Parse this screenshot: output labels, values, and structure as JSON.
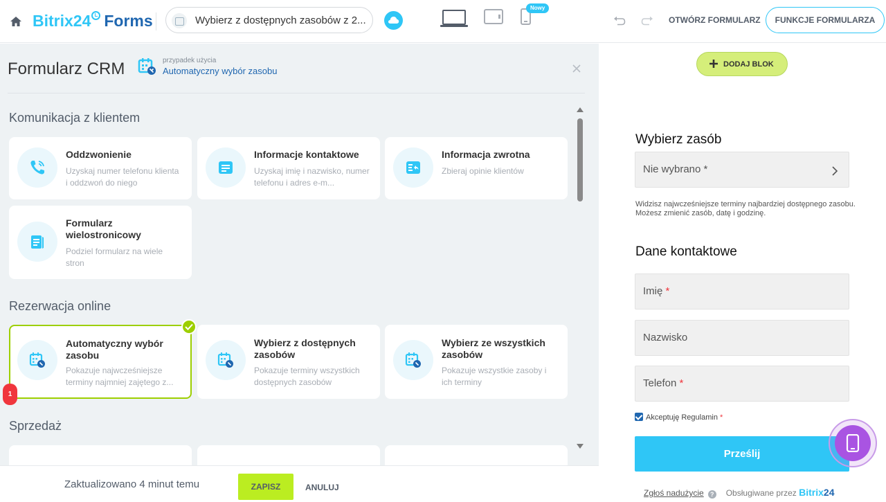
{
  "header": {
    "logo_bitrix": "Bitrix24",
    "logo_forms": "Forms",
    "scenario_select": "Wybierz z dostępnych zasobów z 2...",
    "new_badge": "Nowy",
    "open_form": "OTWÓRZ FORMULARZ",
    "form_features": "FUNKCJE FORMULARZA"
  },
  "panel": {
    "title": "Formularz CRM",
    "use_case_label": "przypadek użycia",
    "use_case_value": "Automatyczny wybór zasobu",
    "sections": [
      {
        "title": "Komunikacja z klientem",
        "cards": [
          {
            "title": "Oddzwonienie",
            "desc": "Uzyskaj numer telefonu klienta i oddzwoń do niego"
          },
          {
            "title": "Informacje kontaktowe",
            "desc": "Uzyskaj imię i nazwisko, numer telefonu i adres e-m..."
          },
          {
            "title": "Informacja zwrotna",
            "desc": "Zbieraj opinie klientów"
          },
          {
            "title": "Formularz wielostronicowy",
            "desc": "Podziel formularz na wiele stron"
          }
        ]
      },
      {
        "title": "Rezerwacja online",
        "cards": [
          {
            "title": "Automatyczny wybór zasobu",
            "desc": "Pokazuje najwcześniejsze terminy najmniej zajętego z..."
          },
          {
            "title": "Wybierz z dostępnych zasobów",
            "desc": "Pokazuje terminy wszystkich dostępnych zasobów"
          },
          {
            "title": "Wybierz ze wszystkich zasobów",
            "desc": "Pokazuje wszystkie zasoby i ich terminy"
          }
        ]
      },
      {
        "title": "Sprzedaż",
        "cards": []
      }
    ],
    "notification_count": "1"
  },
  "bottom": {
    "updated": "Zaktualizowano 4 minut temu",
    "save": "ZAPISZ",
    "cancel": "ANULUJ"
  },
  "preview": {
    "add_block": "DODAJ BLOK",
    "resource_title": "Wybierz zasób",
    "resource_placeholder": "Nie wybrano *",
    "resource_note": "Widzisz najwcześniejsze terminy najbardziej dostępnego zasobu. Możesz zmienić zasób, datę i godzinę.",
    "contact_title": "Dane kontaktowe",
    "fields": [
      {
        "label": "Imię",
        "required": "*"
      },
      {
        "label": "Nazwisko",
        "required": ""
      },
      {
        "label": "Telefon",
        "required": "*"
      }
    ],
    "agree_text": "Akceptuję Regulamin",
    "agree_required": "*",
    "submit": "Prześlij",
    "report_abuse": "Zgłoś nadużycie",
    "powered_by": "Obsługiwane przez",
    "powered_brand": "Bitrix",
    "powered_brand_num": "24"
  },
  "colors": {
    "accent": "#2fc6f6",
    "brand_dark": "#2067b0",
    "save_green": "#bbed21",
    "selected_border": "#9dcf00",
    "badge_red": "#f0363d",
    "fab_purple": "#a954e2"
  }
}
